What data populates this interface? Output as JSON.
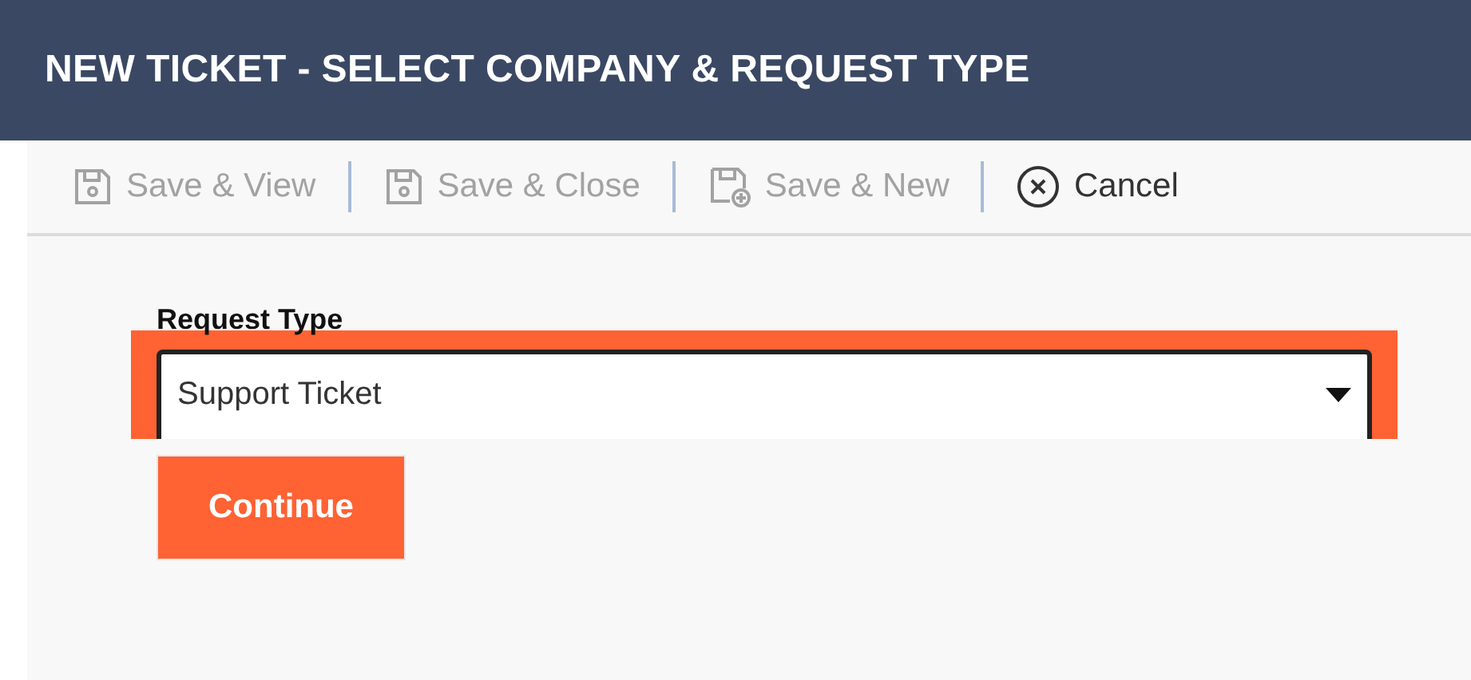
{
  "window": {
    "title": "NEW TICKET - SELECT COMPANY & REQUEST TYPE"
  },
  "toolbar": [
    {
      "label": "Save & View",
      "kind": "save",
      "disabled": true
    },
    {
      "label": "Save & Close",
      "kind": "save",
      "disabled": true
    },
    {
      "label": "Save & New",
      "kind": "save-new",
      "disabled": true
    },
    {
      "label": "Cancel",
      "kind": "cancel",
      "disabled": false
    }
  ],
  "form": {
    "label": "Request Type",
    "value": "Support Ticket",
    "highlighted": true
  },
  "buttons": [
    "Continue"
  ]
}
